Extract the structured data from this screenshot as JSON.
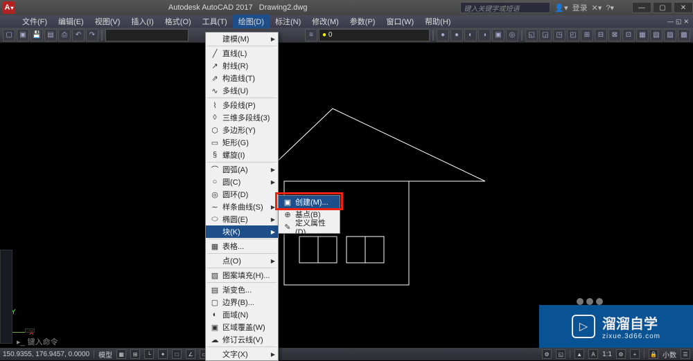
{
  "title": {
    "app": "Autodesk AutoCAD 2017",
    "doc": "Drawing2.dwg",
    "search_placeholder": "键入关键字或短语",
    "login": "登录"
  },
  "menubar": {
    "items": [
      {
        "label": "文件(F)"
      },
      {
        "label": "编辑(E)"
      },
      {
        "label": "视图(V)"
      },
      {
        "label": "插入(I)"
      },
      {
        "label": "格式(O)"
      },
      {
        "label": "工具(T)"
      },
      {
        "label": "绘图(D)",
        "active": true
      },
      {
        "label": "标注(N)"
      },
      {
        "label": "修改(M)"
      },
      {
        "label": "参数(P)"
      },
      {
        "label": "窗口(W)"
      },
      {
        "label": "帮助(H)"
      }
    ]
  },
  "toolbar": {
    "layer_dd": "0"
  },
  "dropdown": {
    "items": [
      {
        "icon": "",
        "label": "建模(M)",
        "arrow": true,
        "sep": true
      },
      {
        "icon": "╱",
        "label": "直线(L)"
      },
      {
        "icon": "↗",
        "label": "射线(R)"
      },
      {
        "icon": "⇗",
        "label": "构造线(T)"
      },
      {
        "icon": "∿",
        "label": "多线(U)",
        "sep": true
      },
      {
        "icon": "⌇",
        "label": "多段线(P)"
      },
      {
        "icon": "◊",
        "label": "三维多段线(3)"
      },
      {
        "icon": "⬡",
        "label": "多边形(Y)"
      },
      {
        "icon": "▭",
        "label": "矩形(G)"
      },
      {
        "icon": "§",
        "label": "螺旋(I)",
        "sep": true
      },
      {
        "icon": "⌒",
        "label": "圆弧(A)",
        "arrow": true
      },
      {
        "icon": "○",
        "label": "圆(C)",
        "arrow": true
      },
      {
        "icon": "◎",
        "label": "圆环(D)"
      },
      {
        "icon": "∼",
        "label": "样条曲线(S)",
        "arrow": true
      },
      {
        "icon": "⬭",
        "label": "椭圆(E)",
        "arrow": true
      },
      {
        "icon": "",
        "label": "块(K)",
        "arrow": true,
        "highlight": true,
        "sep": true
      },
      {
        "icon": "▦",
        "label": "表格...",
        "sep": true
      },
      {
        "icon": "",
        "label": "点(O)",
        "arrow": true,
        "sep": true
      },
      {
        "icon": "▨",
        "label": "图案填充(H)...",
        "sep": true
      },
      {
        "icon": "▤",
        "label": "渐变色..."
      },
      {
        "icon": "▢",
        "label": "边界(B)..."
      },
      {
        "icon": "◐",
        "label": "面域(N)"
      },
      {
        "icon": "▣",
        "label": "区域覆盖(W)"
      },
      {
        "icon": "☁",
        "label": "修订云线(V)",
        "sep": true
      },
      {
        "icon": "",
        "label": "文字(X)",
        "arrow": true
      }
    ]
  },
  "submenu": {
    "items": [
      {
        "icon": "▣",
        "label": "创建(M)...",
        "highlight": true
      },
      {
        "icon": "⊕",
        "label": "基点(B)"
      },
      {
        "icon": "✎",
        "label": "定义属性(D)..."
      }
    ]
  },
  "ucs": {
    "y": "Y",
    "x": "X"
  },
  "cmdline": {
    "text": "键入命令"
  },
  "coordbox": {
    "text": ""
  },
  "statusbar": {
    "coords": "150.9355, 176.9457, 0.0000",
    "tab": "模型",
    "scale": "1:1",
    "units": "小数"
  },
  "watermark": {
    "brand": "溜溜自学",
    "url": "zixue.3d66.com"
  }
}
